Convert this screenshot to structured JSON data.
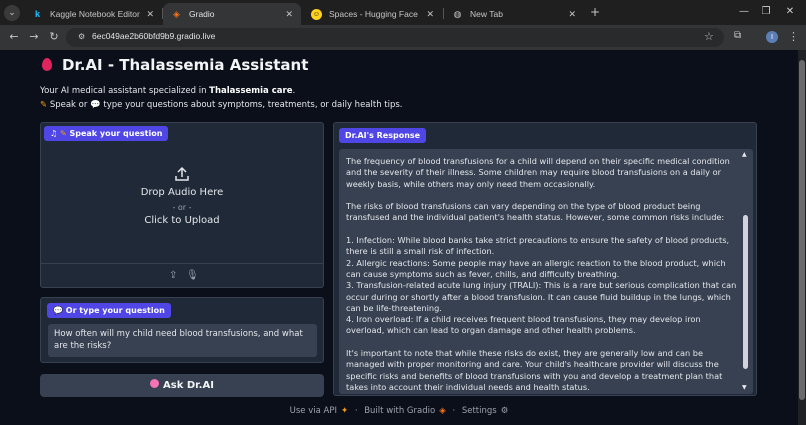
{
  "browser": {
    "tabs": [
      {
        "title": "Kaggle Notebook Editor",
        "favicon": "k",
        "active": false
      },
      {
        "title": "Gradio",
        "favicon": "gradio-icon",
        "active": true
      },
      {
        "title": "Spaces - Hugging Face",
        "favicon": "hf-icon",
        "active": false
      },
      {
        "title": "New Tab",
        "favicon": "globe-icon",
        "active": false
      }
    ],
    "url": "6ec049ae2b60bfd9b9.gradio.live",
    "profile_initial": "I"
  },
  "app": {
    "title": "Dr.AI - Thalassemia Assistant",
    "intro_prefix": "Your AI medical assistant specialized in ",
    "intro_bold": "Thalassemia care",
    "intro_suffix": ".",
    "intro_line2_a": "Speak or ",
    "intro_line2_b": " type your questions about symptoms, treatments, or daily health tips."
  },
  "audio": {
    "label": "Speak your question",
    "drop_text": "Drop Audio Here",
    "or_text": "- or -",
    "click_text": "Click to Upload"
  },
  "text_input": {
    "label": "Or type your question",
    "value": "How often will my child need blood transfusions, and what are the risks?"
  },
  "ask_button": {
    "label": "Ask Dr.AI"
  },
  "response": {
    "label": "Dr.AI's Response",
    "paragraphs": [
      "The frequency of blood transfusions for a child will depend on their specific medical condition and the severity of their illness. Some children may require blood transfusions on a daily or weekly basis, while others may only need them occasionally.",
      "The risks of blood transfusions can vary depending on the type of blood product being transfused and the individual patient's health status. However, some common risks include:",
      "1. Infection: While blood banks take strict precautions to ensure the safety of blood products, there is still a small risk of infection.\n2. Allergic reactions: Some people may have an allergic reaction to the blood product, which can cause symptoms such as fever, chills, and difficulty breathing.\n3. Transfusion-related acute lung injury (TRALI): This is a rare but serious complication that can occur during or shortly after a blood transfusion. It can cause fluid buildup in the lungs, which can be life-threatening.\n4. Iron overload: If a child receives frequent blood transfusions, they may develop iron overload, which can lead to organ damage and other health problems.",
      "It's important to note that while these risks do exist, they are generally low and can be managed with proper monitoring and care. Your child's healthcare provider will discuss the specific risks and benefits of blood transfusions with you and develop a treatment plan that takes into account their individual needs and health status."
    ]
  },
  "footer": {
    "api": "Use via API",
    "sep": "·",
    "built": "Built with Gradio",
    "settings": "Settings"
  },
  "colors": {
    "accent": "#4f46e5",
    "panel": "#1f2937",
    "background": "#0b0f19"
  }
}
